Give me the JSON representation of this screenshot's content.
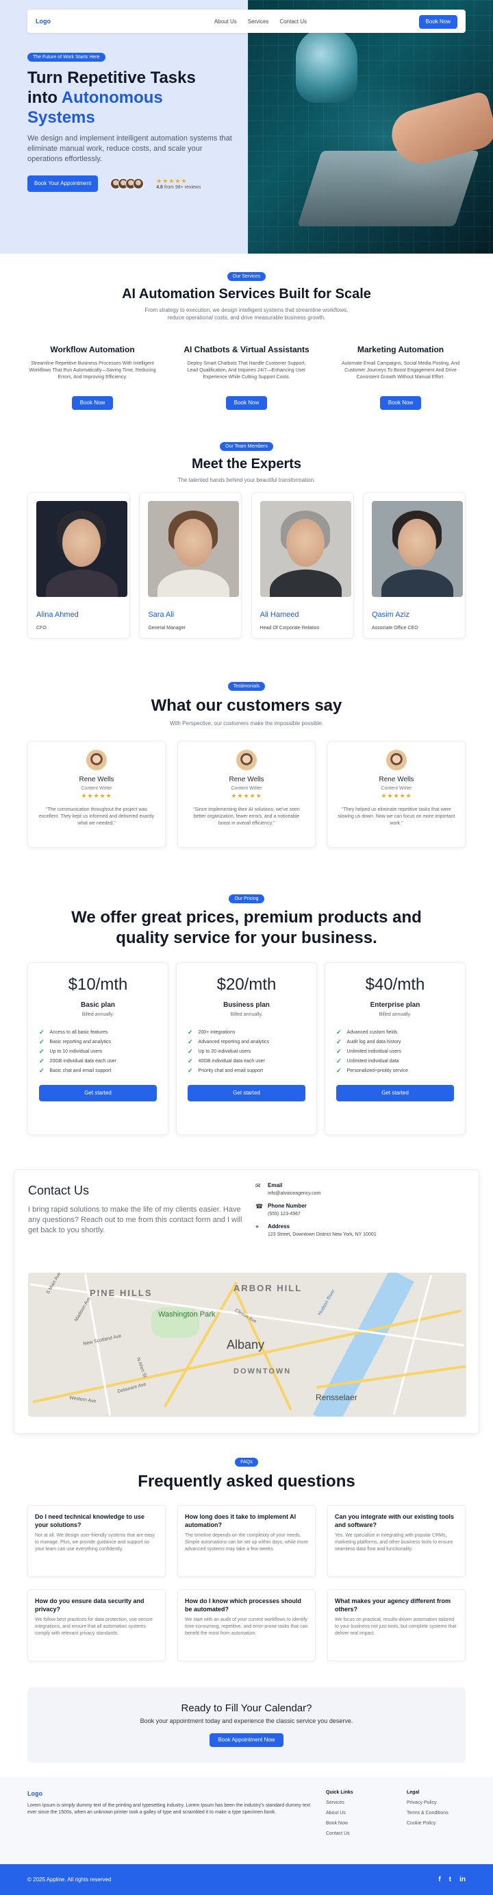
{
  "nav": {
    "logo": "Logo",
    "links": [
      "About Us",
      "Services",
      "Contact Us"
    ],
    "cta": "Book Now"
  },
  "hero": {
    "badge": "The Future of Work Starts Here",
    "title_line1": "Turn Repetitive Tasks",
    "title_into": "into ",
    "title_highlight1": "Autonomous",
    "title_highlight2": "Systems",
    "description": "We design and implement intelligent automation systems that eliminate manual work, reduce costs, and scale your operations effortlessly.",
    "cta": "Book Your Appointment",
    "stars": "★★★★★",
    "rating_value": "4.8",
    "rating_text": "from 98+ reviews"
  },
  "services": {
    "badge": "Our Services",
    "title": "AI Automation Services Built for Scale",
    "subtitle": "From strategy to execution, we design intelligent systems that streamline workflows, reduce operational costs, and drive measurable business growth.",
    "items": [
      {
        "title": "Workflow Automation",
        "text": "Streamline Repetitive Business Processes With Intelligent Workflows That Run Automatically—Saving Time, Reducing Errors, And Improving Efficiency.",
        "cta": "Book Now"
      },
      {
        "title": "AI Chatbots & Virtual Assistants",
        "text": "Deploy Smart Chatbots That Handle Customer Support, Lead Qualification, And Inquiries 24/7—Enhancing User Experience While Cutting Support Costs.",
        "cta": "Book Now"
      },
      {
        "title": "Marketing Automation",
        "text": "Automate Email Campaigns, Social Media Posting, And Customer Journeys To Boost Engagement And Drive Consistent Growth Without Manual Effort.",
        "cta": "Book Now"
      }
    ]
  },
  "team": {
    "badge": "Our Team Members",
    "title": "Meet the Experts",
    "subtitle": "The talented hands behind your beautiful transformation.",
    "members": [
      {
        "name": "Alina Ahmed",
        "role": "CFO"
      },
      {
        "name": "Sara Ali",
        "role": "General Manager"
      },
      {
        "name": "Ali Hameed",
        "role": "Head Of Corporate Relation"
      },
      {
        "name": "Qasim Aziz",
        "role": "Associate Office CEO"
      }
    ]
  },
  "testimonials": {
    "badge": "Testimonials",
    "title": "What our customers say",
    "subtitle": "With Perspective, our customers make the impossible possible.",
    "items": [
      {
        "name": "Rene Wells",
        "role": "Content Writer",
        "stars": "★★★★★",
        "quote": "\"The communication throughout the project was excellent. They kept us informed and delivered exactly what we needed.\""
      },
      {
        "name": "Rene Wells",
        "role": "Content Writer",
        "stars": "★★★★★",
        "quote": "\"Since implementing their AI solutions, we've seen better organization, fewer errors, and a noticeable boost in overall efficiency.\""
      },
      {
        "name": "Rene Wells",
        "role": "Content Writer",
        "stars": "★★★★★",
        "quote": "\"They helped us eliminate repetitive tasks that were slowing us down. Now we can focus on more important work.\""
      }
    ]
  },
  "pricing": {
    "badge": "Our Pricing",
    "title": "We offer great prices, premium products and quality service for your business.",
    "plans": [
      {
        "price": "$10/mth",
        "name": "Basic plan",
        "billed": "Billed annually.",
        "features": [
          "Access to all basic features",
          "Basic reporting and analytics",
          "Up to 10 individual users",
          "20GB individual data each user",
          "Basic chat and email support"
        ],
        "cta": "Get started"
      },
      {
        "price": "$20/mth",
        "name": "Business plan",
        "billed": "Billed annually.",
        "features": [
          "200+ integrations",
          "Advanced reporting and analytics",
          "Up to 20 individual users",
          "40GB individual data each user",
          "Priority chat and email support"
        ],
        "cta": "Get started"
      },
      {
        "price": "$40/mth",
        "name": "Enterprise plan",
        "billed": "Billed annually.",
        "features": [
          "Advanced custom fields",
          "Audit log and data history",
          "Unlimited individual users",
          "Unlimited individual data",
          "Personalized+priotity service"
        ],
        "cta": "Get started"
      }
    ]
  },
  "contact": {
    "title": "Contact Us",
    "lead": "I bring rapid solutions to make the life of my clients easier. Have any questions? Reach out to me from this contact form and I will get back to you shortly.",
    "email_label": "Email",
    "email": "info@alvoiceagency.com",
    "phone_label": "Phone Number",
    "phone": "(555) 123-4567",
    "address_label": "Address",
    "address": "123 Street, Downtown District New York, NY 10001",
    "map_labels": [
      "PINE HILLS",
      "ARBOR HILL",
      "Washington Park",
      "Albany",
      "DOWNTOWN",
      "Rensselaer",
      "Clinton Ave",
      "Hudson River",
      "New Scotland Ave",
      "Delaware Ave",
      "Madison Ave",
      "S Main Ave",
      "N Allen St",
      "Western Ave"
    ]
  },
  "faq": {
    "badge": "FAQs",
    "title": "Frequently asked questions",
    "items": [
      {
        "q": "Do I need technical knowledge to use your solutions?",
        "a": "Not at all. We design user-friendly systems that are easy to manage. Plus, we provide guidance and support so your team can use everything confidently."
      },
      {
        "q": "How long does it take to implement AI automation?",
        "a": "The timeline depends on the complexity of your needs. Simple automations can be set up within days, while more advanced systems may take a few weeks."
      },
      {
        "q": "Can you integrate with our existing tools and software?",
        "a": "Yes. We specialize in integrating with popular CRMs, marketing platforms, and other business tools to ensure seamless data flow and functionality."
      },
      {
        "q": "How do you ensure data security and privacy?",
        "a": "We follow best practices for data protection, use secure integrations, and ensure that all automation systems comply with relevant privacy standards."
      },
      {
        "q": "How do I know which processes should be automated?",
        "a": "We start with an audit of your current workflows to identify time-consuming, repetitive, and error-prone tasks that can benefit the most from automation."
      },
      {
        "q": "What makes your agency different from others?",
        "a": "We focus on practical, results-driven automation tailored to your business not just tools, but complete systems that deliver real impact."
      }
    ]
  },
  "cta": {
    "title": "Ready to Fill Your Calendar?",
    "text": "Book your appointment today and experience the classic service you deserve.",
    "button": "Book Appointment Now"
  },
  "footer": {
    "logo": "Logo",
    "text": "Lorem Ipsum is simply dummy text of the printing and typesetting industry. Lorem Ipsum has been the industry's standard dummy text ever since the 1500s, when an unknown printer took a galley of type and scrambled it to make a type specimen book.",
    "quick_title": "Quick Links",
    "quick_links": [
      "Services",
      "About Us",
      "Book Now",
      "Contact Us"
    ],
    "legal_title": "Legal",
    "legal_links": [
      "Privacy Policy",
      "Terms & Conditions",
      "Cookie Policy"
    ],
    "copyright": "© 2025 Appline. All rights reserved",
    "social": [
      "f",
      "t",
      "in"
    ]
  },
  "colors": {
    "accent": "#2563eb",
    "star": "#f5a623",
    "check": "#22a447"
  }
}
